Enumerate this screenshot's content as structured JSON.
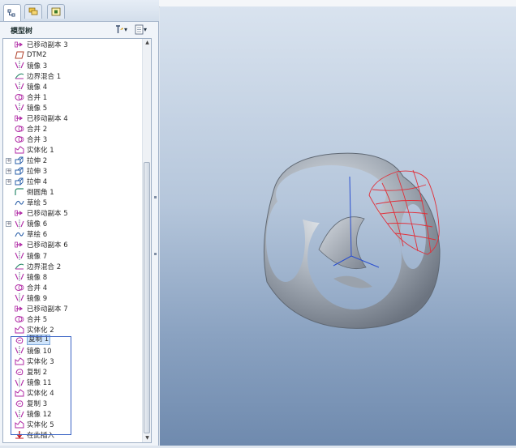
{
  "tabs": [
    {
      "icon": "model-tree-icon",
      "active": true
    },
    {
      "icon": "layers-icon",
      "active": false
    },
    {
      "icon": "favorites-icon",
      "active": false
    }
  ],
  "tree_header": {
    "title": "模型树",
    "settings_icon": "tree-settings-icon",
    "show_icon": "tree-show-icon",
    "dropdown_glyph": "▾"
  },
  "tree": {
    "items": [
      {
        "label": "已移动副本 3",
        "icon": "move-copy-icon",
        "expandable": false
      },
      {
        "label": "DTM2",
        "icon": "datum-plane-icon",
        "expandable": false
      },
      {
        "label": "镜像 3",
        "icon": "mirror-icon",
        "expandable": false
      },
      {
        "label": "边界混合 1",
        "icon": "boundary-blend-icon",
        "expandable": false
      },
      {
        "label": "镜像 4",
        "icon": "mirror-icon",
        "expandable": false
      },
      {
        "label": "合并 1",
        "icon": "merge-icon",
        "expandable": false
      },
      {
        "label": "镜像 5",
        "icon": "mirror-icon",
        "expandable": false
      },
      {
        "label": "已移动副本 4",
        "icon": "move-copy-icon",
        "expandable": false
      },
      {
        "label": "合并 2",
        "icon": "merge-icon",
        "expandable": false
      },
      {
        "label": "合并 3",
        "icon": "merge-icon",
        "expandable": false
      },
      {
        "label": "实体化 1",
        "icon": "solidify-icon",
        "expandable": false
      },
      {
        "label": "拉伸 2",
        "icon": "extrude-icon",
        "expandable": true
      },
      {
        "label": "拉伸 3",
        "icon": "extrude-icon",
        "expandable": true
      },
      {
        "label": "拉伸 4",
        "icon": "extrude-icon",
        "expandable": true
      },
      {
        "label": "倒圆角 1",
        "icon": "round-icon",
        "expandable": false
      },
      {
        "label": "草绘 5",
        "icon": "sketch-icon",
        "expandable": false
      },
      {
        "label": "已移动副本 5",
        "icon": "move-copy-icon",
        "expandable": false
      },
      {
        "label": "镜像 6",
        "icon": "mirror-icon",
        "expandable": true
      },
      {
        "label": "草绘 6",
        "icon": "sketch-icon",
        "expandable": false
      },
      {
        "label": "已移动副本 6",
        "icon": "move-copy-icon",
        "expandable": false
      },
      {
        "label": "镜像 7",
        "icon": "mirror-icon",
        "expandable": false
      },
      {
        "label": "边界混合 2",
        "icon": "boundary-blend-icon",
        "expandable": false
      },
      {
        "label": "镜像 8",
        "icon": "mirror-icon",
        "expandable": false
      },
      {
        "label": "合并 4",
        "icon": "merge-icon",
        "expandable": false
      },
      {
        "label": "镜像 9",
        "icon": "mirror-icon",
        "expandable": false
      },
      {
        "label": "已移动副本 7",
        "icon": "move-copy-icon",
        "expandable": false
      },
      {
        "label": "合并 5",
        "icon": "merge-icon",
        "expandable": false
      },
      {
        "label": "实体化 2",
        "icon": "solidify-icon",
        "expandable": false
      },
      {
        "label": "复制 1",
        "icon": "copy-icon",
        "expandable": false,
        "selected": true
      },
      {
        "label": "镜像 10",
        "icon": "mirror-icon",
        "expandable": false
      },
      {
        "label": "实体化 3",
        "icon": "solidify-icon",
        "expandable": false
      },
      {
        "label": "复制 2",
        "icon": "copy-icon",
        "expandable": false
      },
      {
        "label": "镜像 11",
        "icon": "mirror-icon",
        "expandable": false
      },
      {
        "label": "实体化 4",
        "icon": "solidify-icon",
        "expandable": false
      },
      {
        "label": "复制 3",
        "icon": "copy-icon",
        "expandable": false
      },
      {
        "label": "镜像 12",
        "icon": "mirror-icon",
        "expandable": false
      },
      {
        "label": "实体化 5",
        "icon": "solidify-icon",
        "expandable": false
      },
      {
        "label": "在此插入",
        "icon": "insert-here-icon",
        "expandable": false
      }
    ]
  },
  "colors": {
    "feature_magenta": "#b02aa5",
    "selection_blue": "#3a63c4",
    "viewport_top": "#d9e3ef",
    "viewport_bottom": "#6f8aae",
    "model_gray": "#a9b0b8",
    "highlight_red": "#e0303a"
  }
}
